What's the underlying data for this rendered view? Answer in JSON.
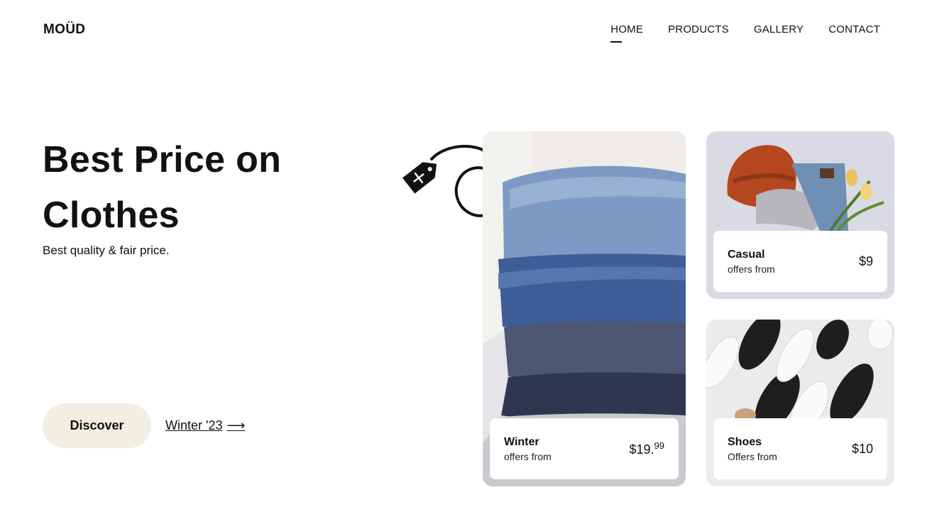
{
  "brand": "MOÜD",
  "nav": [
    "HOME",
    "PRODUCTS",
    "GALLERY",
    "CONTACT"
  ],
  "hero": {
    "title_line1": "Best Price on",
    "title_line2": "Clothes",
    "subtitle": "Best quality & fair price.",
    "cta_label": "Discover",
    "link_label": "Winter '23",
    "link_arrow": "⟶"
  },
  "cards": [
    {
      "name": "Winter",
      "sub": "offers from",
      "price_main": "$19.",
      "price_cents": "99"
    },
    {
      "name": "Casual",
      "sub": "offers from",
      "price_main": "$9"
    },
    {
      "name": "Shoes",
      "sub": "Offers from",
      "price_main": "$10"
    }
  ]
}
